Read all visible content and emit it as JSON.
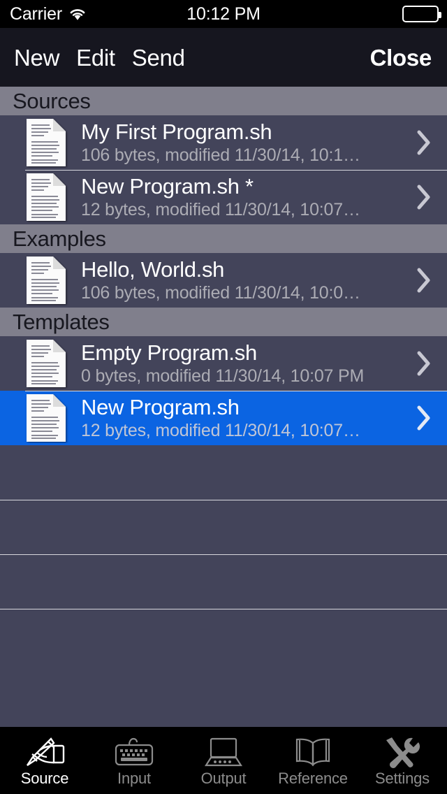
{
  "status_bar": {
    "carrier": "Carrier",
    "wifi_icon": "wifi-icon",
    "time": "10:12 PM",
    "battery_icon": "battery-full-icon"
  },
  "nav_bar": {
    "background": "#16161F",
    "left_buttons": [
      {
        "label": "New",
        "name": "new-button"
      },
      {
        "label": "Edit",
        "name": "edit-button"
      },
      {
        "label": "Send",
        "name": "send-button"
      }
    ],
    "right_button": {
      "label": "Close",
      "name": "close-button"
    }
  },
  "list": {
    "background": "#43445A",
    "header_background": "#807F8C",
    "selected_background": "#0B64E2",
    "separator_color": "#D8D8DE",
    "sections": [
      {
        "title": "Sources",
        "rows": [
          {
            "title": "My First Program.sh",
            "subtitle": "106 bytes, modified 11/30/14, 10:1…",
            "icon": "document-icon",
            "accessory": "chevron-right-icon",
            "selected": false
          },
          {
            "title": "New Program.sh *",
            "subtitle": "12 bytes, modified 11/30/14, 10:07…",
            "icon": "document-icon",
            "accessory": "chevron-right-icon",
            "selected": false
          }
        ]
      },
      {
        "title": "Examples",
        "rows": [
          {
            "title": "Hello, World.sh",
            "subtitle": "106 bytes, modified 11/30/14, 10:0…",
            "icon": "document-icon",
            "accessory": "chevron-right-icon",
            "selected": false
          }
        ]
      },
      {
        "title": "Templates",
        "rows": [
          {
            "title": "Empty Program.sh",
            "subtitle": "0 bytes, modified 11/30/14, 10:07 PM",
            "icon": "document-icon",
            "accessory": "chevron-right-icon",
            "selected": false
          },
          {
            "title": "New Program.sh",
            "subtitle": "12 bytes, modified 11/30/14, 10:07…",
            "icon": "document-icon",
            "accessory": "chevron-right-icon",
            "selected": true
          }
        ]
      }
    ],
    "empty_row_count": 4
  },
  "tab_bar": {
    "background": "#000000",
    "active_color": "#FFFFFF",
    "inactive_color": "#8C8C8C",
    "tabs": [
      {
        "label": "Source",
        "icon": "writing-hand-icon",
        "active": true
      },
      {
        "label": "Input",
        "icon": "keyboard-icon",
        "active": false
      },
      {
        "label": "Output",
        "icon": "laptop-icon",
        "active": false
      },
      {
        "label": "Reference",
        "icon": "open-book-icon",
        "active": false
      },
      {
        "label": "Settings",
        "icon": "tools-icon",
        "active": false
      }
    ]
  }
}
